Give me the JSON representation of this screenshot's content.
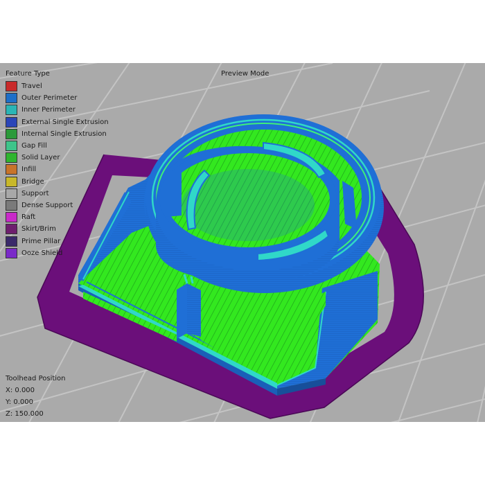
{
  "legend": {
    "title": "Feature Type",
    "items": [
      {
        "label": "Travel",
        "color": "#c92a2a"
      },
      {
        "label": "Outer Perimeter",
        "color": "#1e6fc8"
      },
      {
        "label": "Inner Perimeter",
        "color": "#2bb5b5"
      },
      {
        "label": "External Single Extrusion",
        "color": "#2a45b8"
      },
      {
        "label": "Internal Single Extrusion",
        "color": "#2a9a3a"
      },
      {
        "label": "Gap Fill",
        "color": "#3ec48a"
      },
      {
        "label": "Solid Layer",
        "color": "#2fb52f"
      },
      {
        "label": "Infill",
        "color": "#c8742a"
      },
      {
        "label": "Bridge",
        "color": "#c8b82a"
      },
      {
        "label": "Support",
        "color": "#a8a8a8"
      },
      {
        "label": "Dense Support",
        "color": "#7a7a7a"
      },
      {
        "label": "Raft",
        "color": "#c92ac9"
      },
      {
        "label": "Skirt/Brim",
        "color": "#6e1f6e"
      },
      {
        "label": "Prime Pillar",
        "color": "#3a2a6a"
      },
      {
        "label": "Ooze Shield",
        "color": "#7a2ac8"
      }
    ]
  },
  "preview_mode_label": "Preview Mode",
  "toolhead": {
    "title": "Toolhead Position",
    "x": "X: 0.000",
    "y": "Y: 0.000",
    "z": "Z: 150.000"
  },
  "colors": {
    "background": "#aaaaaa",
    "grid": "#c4c4c4",
    "outer_wall": "#1f6fd6",
    "solid_layer": "#33e81f",
    "inner_perimeter": "#30d8c8",
    "skirt": "#6b0f7a"
  }
}
